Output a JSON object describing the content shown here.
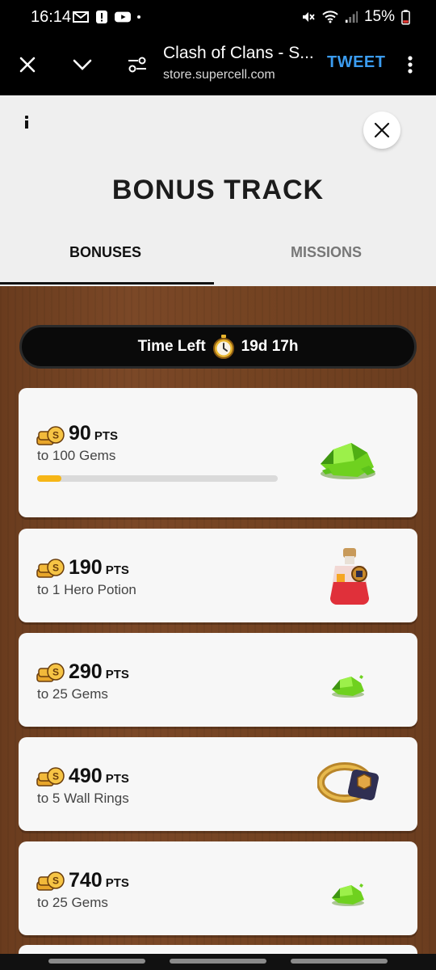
{
  "status": {
    "time": "16:14",
    "battery": "15%",
    "icons": [
      "gmail-icon",
      "alert-icon",
      "youtube-icon",
      "dot-icon",
      "mute-icon",
      "wifi-icon",
      "signal-icon",
      "battery-icon"
    ]
  },
  "browser": {
    "title": "Clash of Clans - S...",
    "url": "store.supercell.com",
    "tweet_label": "TWEET",
    "icons": [
      "close-icon",
      "chevron-down-icon",
      "page-settings-icon",
      "more-vert-icon"
    ]
  },
  "modal": {
    "title": "BONUS TRACK",
    "tabs": [
      {
        "label": "BONUSES",
        "active": true
      },
      {
        "label": "MISSIONS",
        "active": false
      }
    ]
  },
  "timer": {
    "label": "Time Left",
    "value": "19d 17h"
  },
  "bonuses": [
    {
      "points": "90",
      "unit": "PTS",
      "reward": "to 100 Gems",
      "icon": "gem-pile-large-icon",
      "progress": 0.1
    },
    {
      "points": "190",
      "unit": "PTS",
      "reward": "to 1 Hero Potion",
      "icon": "hero-potion-icon"
    },
    {
      "points": "290",
      "unit": "PTS",
      "reward": "to 25 Gems",
      "icon": "gem-small-icon"
    },
    {
      "points": "490",
      "unit": "PTS",
      "reward": "to 5 Wall Rings",
      "icon": "wall-ring-icon"
    },
    {
      "points": "740",
      "unit": "PTS",
      "reward": "to 25 Gems",
      "icon": "gem-small-icon"
    }
  ],
  "colors": {
    "accent_blue": "#3b9cf0",
    "progress_yellow": "#f6b617",
    "wood": "#7b4827"
  }
}
